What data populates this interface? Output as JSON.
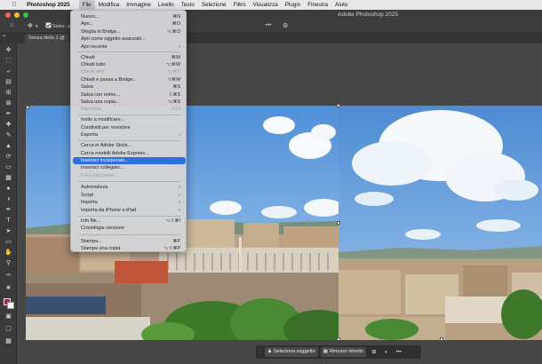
{
  "menubar": {
    "app": "Photoshop 2025",
    "items": [
      "File",
      "Modifica",
      "Immagine",
      "Livello",
      "Testo",
      "Selezione",
      "Filtro",
      "Visualizza",
      "Plugin",
      "Finestra",
      "Aiuto"
    ]
  },
  "window": {
    "title": "Adobe Photoshop 2025"
  },
  "options": {
    "select_label": "Selez. a"
  },
  "doc_tab": {
    "label": "Senza titolo-1 @"
  },
  "panel_toggle": "»",
  "file_menu": {
    "items": [
      {
        "label": "Nuovo...",
        "shortcut": "⌘N",
        "enabled": true
      },
      {
        "label": "Apri...",
        "shortcut": "⌘O",
        "enabled": true
      },
      {
        "label": "Sfoglia in Bridge...",
        "shortcut": "⌥⌘O",
        "enabled": true
      },
      {
        "label": "Apri come oggetto avanzato...",
        "shortcut": "",
        "enabled": true
      },
      {
        "label": "Apri recente",
        "shortcut": "›",
        "enabled": true
      },
      {
        "label": "Chiudi",
        "shortcut": "⌘W",
        "enabled": true
      },
      {
        "label": "Chiudi tutto",
        "shortcut": "⌥⌘W",
        "enabled": true
      },
      {
        "label": "Chiudi altri",
        "shortcut": "⌥⌘P",
        "enabled": false
      },
      {
        "label": "Chiudi e passa a Bridge...",
        "shortcut": "⇧⌘W",
        "enabled": true
      },
      {
        "label": "Salva",
        "shortcut": "⌘S",
        "enabled": true
      },
      {
        "label": "Salva con nome...",
        "shortcut": "⇧⌘S",
        "enabled": true
      },
      {
        "label": "Salva una copia...",
        "shortcut": "⌥⌘S",
        "enabled": true
      },
      {
        "label": "Ripristina",
        "shortcut": "F12",
        "enabled": false
      },
      {
        "label": "Invito a modificare...",
        "shortcut": "",
        "enabled": true
      },
      {
        "label": "Condividi per revisione",
        "shortcut": "",
        "enabled": true
      },
      {
        "label": "Esporta",
        "shortcut": "›",
        "enabled": true
      },
      {
        "label": "Cerca in Adobe Stock...",
        "shortcut": "",
        "enabled": true
      },
      {
        "label": "Cerca modelli Adobe Express...",
        "shortcut": "",
        "enabled": true
      },
      {
        "label": "Inserisci incorporato...",
        "shortcut": "",
        "enabled": true,
        "highlighted": true
      },
      {
        "label": "Inserisci collegato...",
        "shortcut": "",
        "enabled": true
      },
      {
        "label": "Crea pacchetto...",
        "shortcut": "",
        "enabled": false
      },
      {
        "label": "Automatizza",
        "shortcut": "›",
        "enabled": true
      },
      {
        "label": "Script",
        "shortcut": "›",
        "enabled": true
      },
      {
        "label": "Importa",
        "shortcut": "›",
        "enabled": true
      },
      {
        "label": "Importa da iPhone o iPad",
        "shortcut": "›",
        "enabled": true
      },
      {
        "label": "Info file...",
        "shortcut": "⌥⇧⌘I",
        "enabled": true
      },
      {
        "label": "Cronologia versione",
        "shortcut": "",
        "enabled": true
      },
      {
        "label": "Stampa...",
        "shortcut": "⌘P",
        "enabled": true
      },
      {
        "label": "Stampa una copia",
        "shortcut": "⌥⇧⌘P",
        "enabled": true
      }
    ]
  },
  "taskbar": {
    "select_subject": "Seleziona soggetto",
    "remove_background": "Rimuovi sfondo",
    "more": "•••"
  },
  "colors": {
    "foreground": "#c8143c",
    "background": "#ffffff",
    "menu_highlight": "#2e6fe0"
  },
  "icons": {
    "home": "home-icon",
    "move": "move-icon",
    "gear": "gear-icon",
    "ellipsis": "more-icon"
  }
}
